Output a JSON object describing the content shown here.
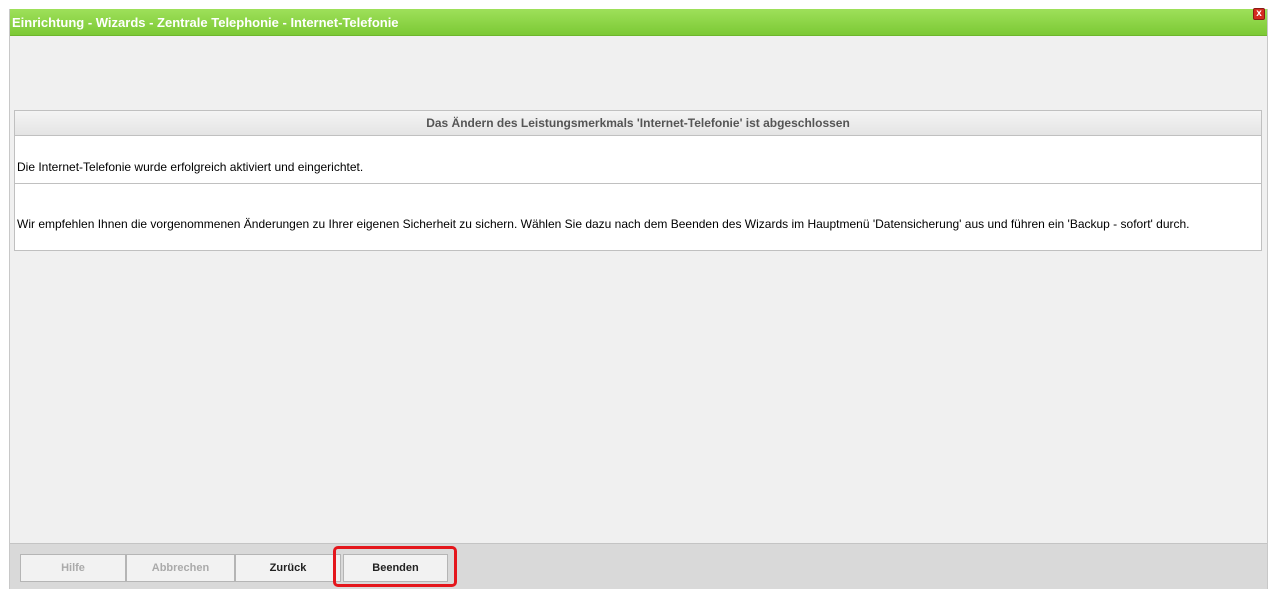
{
  "window": {
    "title": "Einrichtung - Wizards - Zentrale Telephonie - Internet-Telefonie",
    "close_label": "x"
  },
  "panel": {
    "header": "Das Ändern des Leistungsmerkmals 'Internet-Telefonie' ist abgeschlossen",
    "success_message": "Die Internet-Telefonie wurde erfolgreich aktiviert und eingerichtet.",
    "recommendation": "Wir empfehlen Ihnen die vorgenommenen Änderungen zu Ihrer eigenen Sicherheit zu sichern. Wählen Sie dazu nach dem Beenden des Wizards im Hauptmenü 'Datensicherung' aus und führen ein 'Backup - sofort' durch."
  },
  "buttons": {
    "help": "Hilfe",
    "cancel": "Abbrechen",
    "back": "Zurück",
    "finish": "Beenden"
  },
  "colors": {
    "titlebar": "#8fd64a",
    "highlight": "#e4161c",
    "close": "#d42a1f"
  }
}
